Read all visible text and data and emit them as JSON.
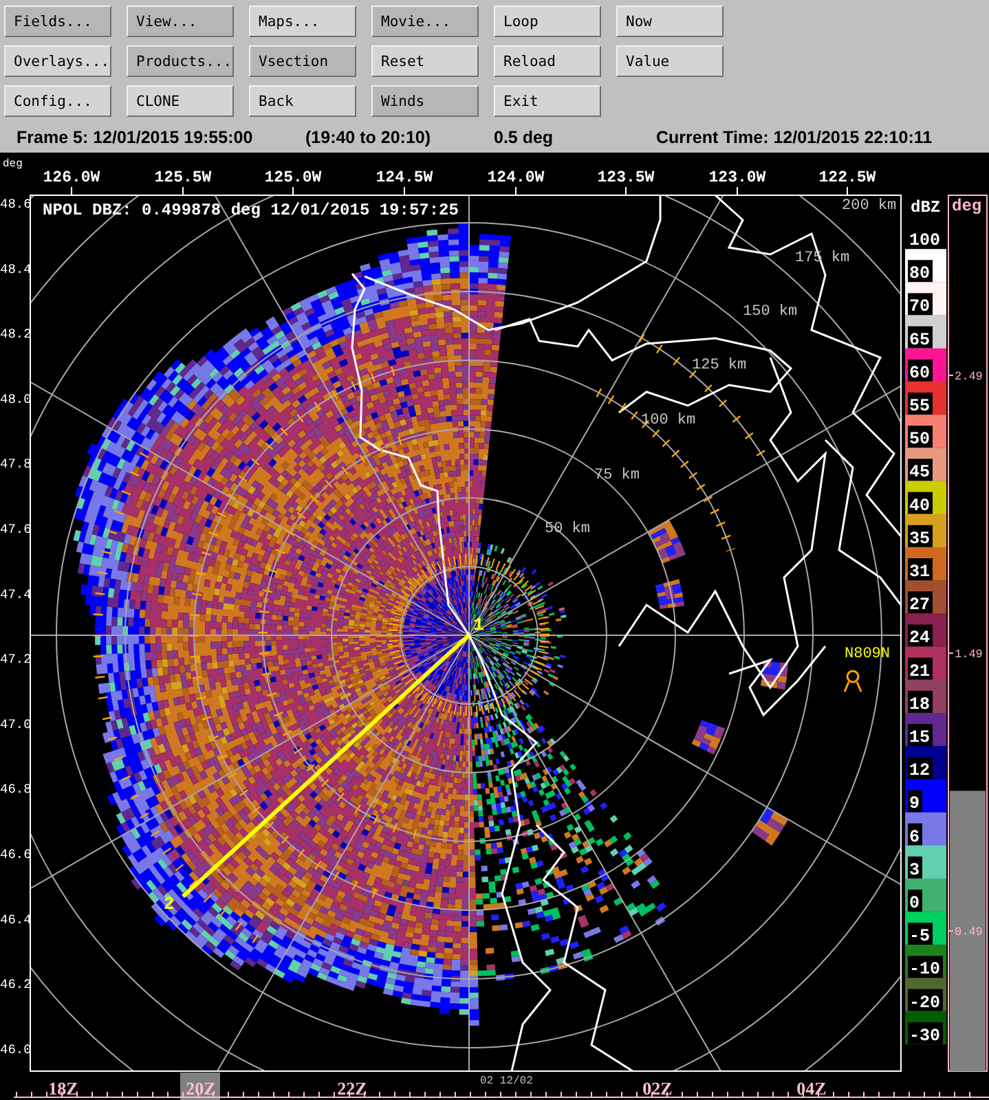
{
  "toolbar": {
    "rows": [
      {
        "buttons": [
          {
            "label": "Fields...",
            "highlighted": true
          },
          {
            "label": "View...",
            "highlighted": true
          },
          {
            "label": "Maps...",
            "highlighted": false
          },
          {
            "label": "Movie...",
            "highlighted": true
          },
          {
            "label": "Loop",
            "highlighted": false
          },
          {
            "label": "Now",
            "highlighted": false
          }
        ]
      },
      {
        "buttons": [
          {
            "label": "Overlays...",
            "highlighted": false
          },
          {
            "label": "Products...",
            "highlighted": true
          },
          {
            "label": "Vsection",
            "highlighted": true
          },
          {
            "label": "Reset",
            "highlighted": false
          },
          {
            "label": "Reload",
            "highlighted": false
          },
          {
            "label": "Value",
            "highlighted": false
          }
        ]
      },
      {
        "buttons": [
          {
            "label": "Config...",
            "highlighted": false
          },
          {
            "label": "CLONE",
            "highlighted": false
          },
          {
            "label": "Back",
            "highlighted": false
          },
          {
            "label": "Winds",
            "highlighted": true
          },
          {
            "label": "Exit",
            "highlighted": false
          }
        ]
      }
    ]
  },
  "status_line": {
    "frame": "Frame 5: 12/01/2015 19:55:00",
    "window": "(19:40 to 20:10)",
    "elevation": "0.5 deg",
    "current_time": "Current Time: 12/01/2015 22:10:11"
  },
  "display": {
    "axis_unit": "deg",
    "longitude_labels": [
      "126.0W",
      "125.5W",
      "125.0W",
      "124.5W",
      "124.0W",
      "123.5W",
      "123.0W",
      "122.5W"
    ],
    "latitude_labels": [
      "48.6",
      "48.4",
      "48.2",
      "48.0",
      "47.8",
      "47.6",
      "47.4",
      "47.2",
      "47.0",
      "46.8",
      "46.6",
      "46.4",
      "46.2",
      "46.0"
    ],
    "title": "NPOL DBZ: 0.499878 deg 12/01/2015 19:57:25",
    "range_labels": [
      "200 km",
      "175 km",
      "150 km",
      "125 km",
      "100 km",
      "75 km",
      "50 km"
    ],
    "aircraft_label": "N809N",
    "point_labels": [
      "1",
      "2"
    ]
  },
  "color_scale": {
    "unit": "dBZ",
    "entries": [
      {
        "label": "100",
        "color": "#000000"
      },
      {
        "label": "80",
        "color": "#ffffff"
      },
      {
        "label": "70",
        "color": "#fff4f4"
      },
      {
        "label": "65",
        "color": "#d0d0d0"
      },
      {
        "label": "60",
        "color": "#ff1493"
      },
      {
        "label": "55",
        "color": "#e83030"
      },
      {
        "label": "50",
        "color": "#f88070"
      },
      {
        "label": "45",
        "color": "#e89a80"
      },
      {
        "label": "40",
        "color": "#cccc00"
      },
      {
        "label": "35",
        "color": "#d8a020"
      },
      {
        "label": "31",
        "color": "#d06820"
      },
      {
        "label": "27",
        "color": "#a05030"
      },
      {
        "label": "24",
        "color": "#882050"
      },
      {
        "label": "21",
        "color": "#b03060"
      },
      {
        "label": "18",
        "color": "#904060"
      },
      {
        "label": "15",
        "color": "#602890"
      },
      {
        "label": "12",
        "color": "#000090"
      },
      {
        "label": "9",
        "color": "#0000ff"
      },
      {
        "label": "6",
        "color": "#7878e8"
      },
      {
        "label": "3",
        "color": "#60d0b0"
      },
      {
        "label": "0",
        "color": "#40b070"
      },
      {
        "label": "-5",
        "color": "#00d060"
      },
      {
        "label": "-10",
        "color": "#208020"
      },
      {
        "label": "-20",
        "color": "#506830"
      },
      {
        "label": "-30",
        "color": "#006000"
      }
    ]
  },
  "elevation_bar": {
    "unit": "deg",
    "readings": [
      "2.49",
      "1.49",
      "0.49"
    ],
    "level": 0.32
  },
  "time_axis": {
    "date_label": "02 12/02",
    "labels": [
      {
        "label": "18Z",
        "selected": false
      },
      {
        "label": "20Z",
        "selected": true
      },
      {
        "label": "22Z",
        "selected": false
      },
      {
        "label": "02Z",
        "selected": false
      },
      {
        "label": "04Z",
        "selected": false
      }
    ]
  }
}
